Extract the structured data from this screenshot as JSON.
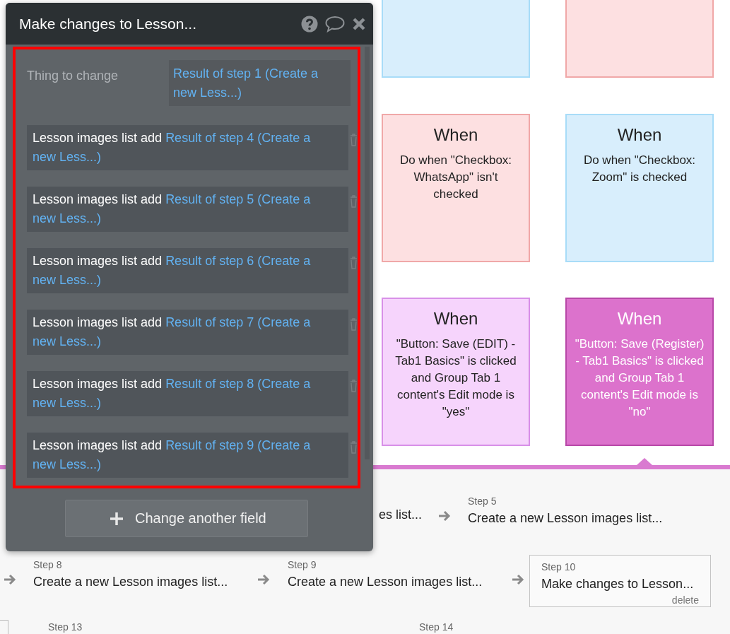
{
  "panel": {
    "title": "Make changes to Lesson...",
    "thing_label": "Thing to change",
    "thing_value": "Result of step 1 (Create a new Less...)",
    "fields": [
      {
        "label": "Lesson images list add",
        "value": "Result of step 4 (Create a new Less...)"
      },
      {
        "label": "Lesson images list add",
        "value": "Result of step 5 (Create a new Less...)"
      },
      {
        "label": "Lesson images list add",
        "value": "Result of step 6 (Create a new Less...)"
      },
      {
        "label": "Lesson images list add",
        "value": "Result of step 7 (Create a new Less...)"
      },
      {
        "label": "Lesson images list add",
        "value": "Result of step 8 (Create a new Less...)"
      },
      {
        "label": "Lesson images list add",
        "value": "Result of step 9 (Create a new Less...)"
      }
    ],
    "add_button": "Change another field"
  },
  "event_cards": [
    {
      "color": "#d8eefc",
      "selected": false
    },
    {
      "color": "#fde0e1",
      "selected": false
    },
    {
      "title": "When",
      "text": "Do when \"Checkbox: WhatsApp\" isn't checked",
      "color": "#fde0e1",
      "selected": false
    },
    {
      "title": "When",
      "text": "Do when \"Checkbox: Zoom\" is checked",
      "color": "#d8eefc",
      "selected": false
    },
    {
      "title": "When",
      "text": "\"Button: Save (EDIT) - Tab1 Basics\" is clicked and Group Tab 1 content's Edit mode is \"yes\"",
      "color": "#f6d4fc",
      "selected": false
    },
    {
      "title": "When",
      "text": "\"Button: Save (Register) - Tab1 Basics\" is clicked and Group Tab 1 content's Edit mode is \"no\"",
      "color": "#dc72cc",
      "selected": true
    }
  ],
  "steps": [
    {
      "title": "es list...",
      "selected": false
    },
    {
      "label": "Step 5",
      "title": "Create a new Lesson images list...",
      "selected": false
    },
    {
      "label": "Step 8",
      "title": "Create a new Lesson images list...",
      "selected": false
    },
    {
      "label": "Step 9",
      "title": "Create a new Lesson images list...",
      "selected": false
    },
    {
      "label": "Step 10",
      "title": "Make changes to Lesson...",
      "delete": "delete",
      "selected": true
    },
    {
      "label": "Step 13",
      "selected": false
    },
    {
      "label": "Step 14",
      "selected": false
    }
  ]
}
